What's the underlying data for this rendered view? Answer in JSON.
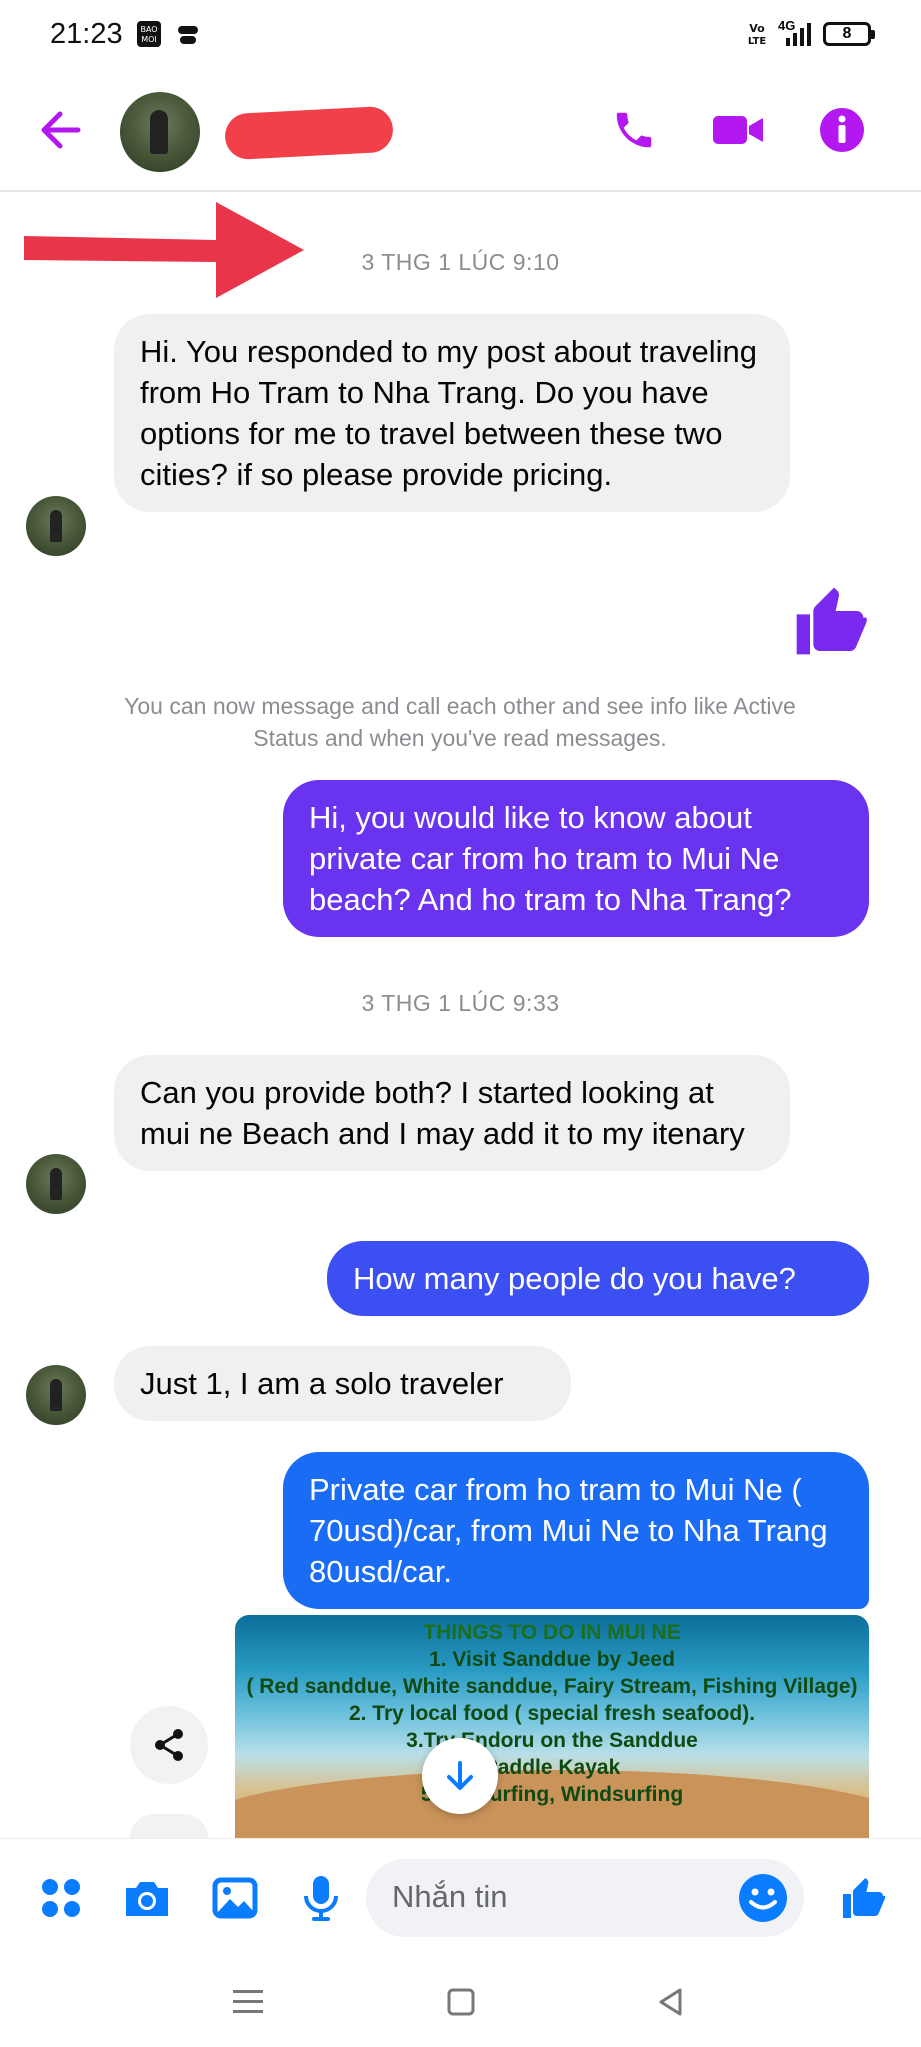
{
  "status_bar": {
    "time": "21:23",
    "battery": "8",
    "network": "4G"
  },
  "header": {
    "back_icon": "arrow-left-icon",
    "call_icon": "phone-icon",
    "video_icon": "video-camera-icon",
    "info_icon": "info-icon",
    "accent": "#b318f0"
  },
  "messages": [
    {
      "type": "timestamp",
      "text": "3 THG 1 LÚC 9:10"
    },
    {
      "type": "incoming",
      "text": "Hi.  You responded to my post about traveling from Ho Tram to Nha Trang. Do you have options for me to travel between these two cities?  if so please provide pricing."
    },
    {
      "type": "like",
      "icon": "thumbs-up-icon"
    },
    {
      "type": "notice",
      "text": "You can now message and call each other and see info like Active Status and when you've read messages."
    },
    {
      "type": "outgoing",
      "text": "Hi, you would like to know about private car from ho tram to Mui Ne beach? And ho tram to Nha Trang?",
      "color": "#6a33f0"
    },
    {
      "type": "timestamp",
      "text": "3 THG 1 LÚC 9:33"
    },
    {
      "type": "incoming",
      "text": "Can you provide both?  I started looking at mui ne Beach and I may add it to my itenary"
    },
    {
      "type": "outgoing",
      "text": "How many people do you have?",
      "color": "#3b4ff2"
    },
    {
      "type": "incoming",
      "text": "Just 1, I am a solo traveler"
    },
    {
      "type": "outgoing",
      "text": "Private car from ho tram to Mui Ne ( 70usd)/car, from Mui Ne to Nha Trang 80usd/car.",
      "color": "#1a6cf5"
    }
  ],
  "photo_lines": [
    "THINGS TO DO IN MUI NE",
    "1. Visit Sanddue by Jeed",
    "( Red sanddue, White sanddue, Fairy Stream, Fishing Village)",
    "2. Try local food ( special fresh seafood).",
    "3.Try Endoru on the Sanddue",
    "Paddle Kayak",
    "5.Try Surfing, Windsurfing"
  ],
  "composer": {
    "placeholder": "Nhắn tin",
    "accent": "#0a7cff"
  }
}
